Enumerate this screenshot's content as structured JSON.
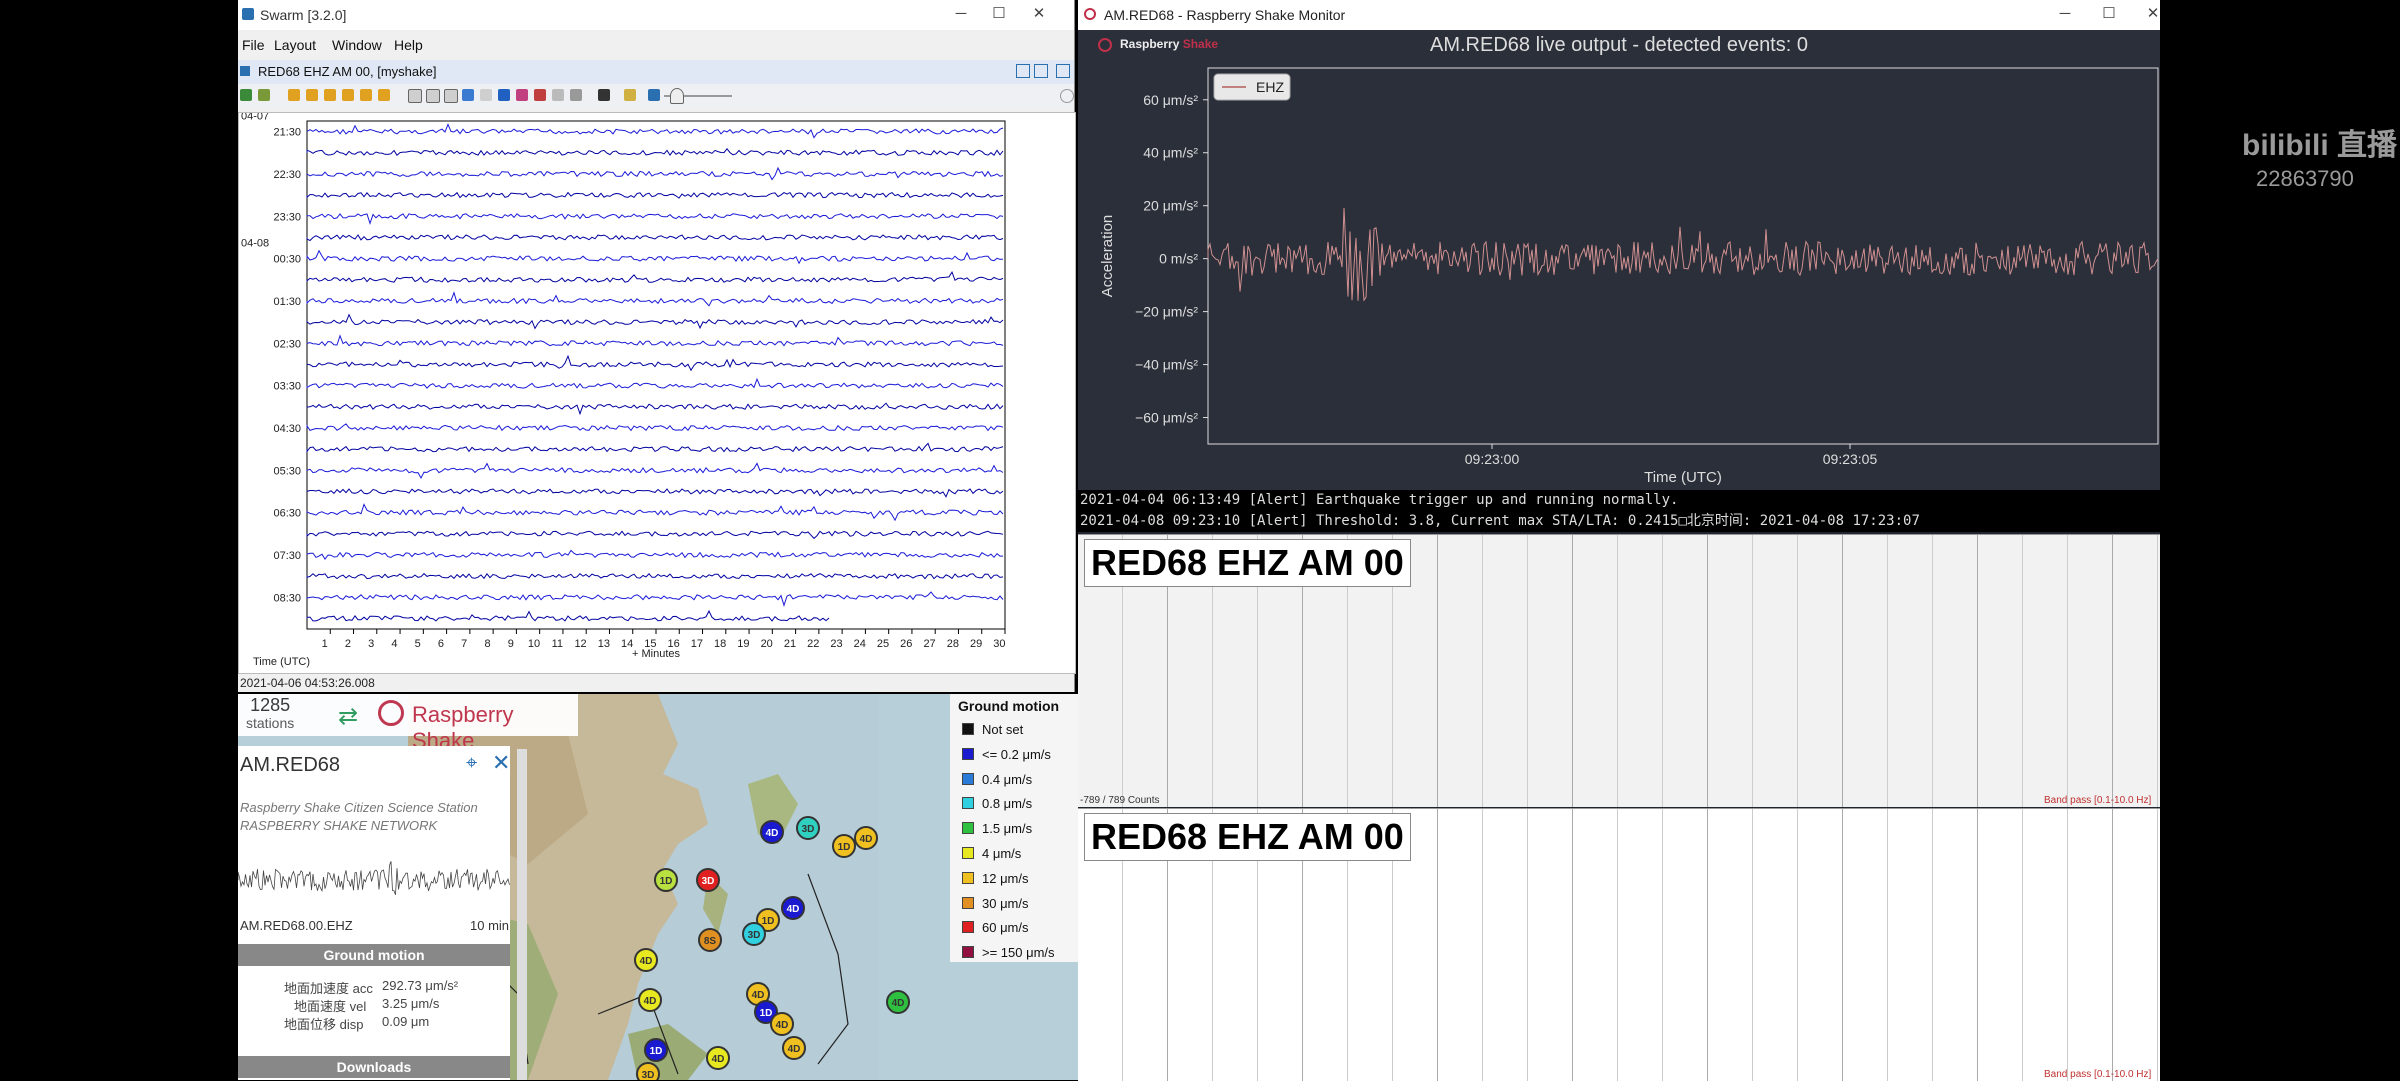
{
  "swarm": {
    "title": "Swarm [3.2.0]",
    "menu": [
      "File",
      "Layout",
      "Window",
      "Help"
    ],
    "subtitle": "RED68 EHZ AM 00, [myshake]",
    "row_labels": [
      {
        "time": "21:30",
        "date": "04-07"
      },
      {
        "time": "22:30",
        "date": ""
      },
      {
        "time": "23:30",
        "date": ""
      },
      {
        "time": "00:30",
        "date": "04-08"
      },
      {
        "time": "01:30",
        "date": ""
      },
      {
        "time": "02:30",
        "date": ""
      },
      {
        "time": "03:30",
        "date": ""
      },
      {
        "time": "04:30",
        "date": ""
      },
      {
        "time": "05:30",
        "date": ""
      },
      {
        "time": "06:30",
        "date": ""
      },
      {
        "time": "07:30",
        "date": ""
      },
      {
        "time": "08:30",
        "date": ""
      }
    ],
    "x_ticks": [
      "1",
      "2",
      "3",
      "4",
      "5",
      "6",
      "7",
      "8",
      "9",
      "10",
      "11",
      "12",
      "13",
      "14",
      "15",
      "16",
      "17",
      "18",
      "19",
      "20",
      "21",
      "22",
      "23",
      "24",
      "25",
      "26",
      "27",
      "28",
      "29",
      "30"
    ],
    "x_label": "+ Minutes",
    "time_label": "Time (UTC)",
    "status": "2021-04-06 04:53:26.008"
  },
  "map": {
    "count": "1285",
    "count_label": "stations",
    "brand": "Raspberry Shake",
    "station": {
      "name": "AM.RED68",
      "desc1": "Raspberry Shake Citizen Science Station",
      "desc2": "RASPBERRY SHAKE NETWORK",
      "trace_label": "AM.RED68.00.EHZ",
      "trace_dur": "10 min",
      "ground_motion_title": "Ground motion",
      "acc_label": "地面加速度 acc",
      "acc_value": "292.73 μm/s²",
      "vel_label": "地面速度 vel",
      "vel_value": "3.25 μm/s",
      "disp_label": "地面位移 disp",
      "disp_value": "0.09 μm",
      "downloads": "Downloads"
    },
    "legend": {
      "title": "Ground motion",
      "items": [
        {
          "label": "Not set",
          "color": "#111111"
        },
        {
          "label": "<= 0.2 μm/s",
          "color": "#1a1ad0"
        },
        {
          "label": "0.4 μm/s",
          "color": "#2a7ad8"
        },
        {
          "label": "0.8 μm/s",
          "color": "#30d0e0"
        },
        {
          "label": "1.5 μm/s",
          "color": "#30c040"
        },
        {
          "label": "4 μm/s",
          "color": "#e8e820"
        },
        {
          "label": "12 μm/s",
          "color": "#f0c020"
        },
        {
          "label": "30 μm/s",
          "color": "#e09020"
        },
        {
          "label": "60 μm/s",
          "color": "#e02020"
        },
        {
          "label": ">= 150 μm/s",
          "color": "#901040"
        }
      ]
    },
    "markers": [
      {
        "label": "1D",
        "color": "#b8e040"
      },
      {
        "label": "3D",
        "color": "#e02020"
      },
      {
        "label": "4D",
        "color": "#1a1ad0"
      },
      {
        "label": "3D",
        "color": "#30d0c0"
      },
      {
        "label": "1D",
        "color": "#f0c020"
      },
      {
        "label": "4D",
        "color": "#f0c020"
      },
      {
        "label": "4D",
        "color": "#1a1ad0"
      },
      {
        "label": "1D",
        "color": "#f0c020"
      },
      {
        "label": "3D",
        "color": "#30d0e0"
      },
      {
        "label": "8S",
        "color": "#e09020"
      },
      {
        "label": "4D",
        "color": "#e8e820"
      },
      {
        "label": "4D",
        "color": "#e8e820"
      },
      {
        "label": "4D",
        "color": "#f0c020"
      },
      {
        "label": "1D",
        "color": "#1a1ad0"
      },
      {
        "label": "4D",
        "color": "#f0c020"
      },
      {
        "label": "4D",
        "color": "#f0c020"
      },
      {
        "label": "4D",
        "color": "#30c040"
      },
      {
        "label": "1D",
        "color": "#1a1ad0"
      },
      {
        "label": "4D",
        "color": "#e8e820"
      },
      {
        "label": "3D",
        "color": "#f0c020"
      }
    ]
  },
  "monitor": {
    "title": "AM.RED68 - Raspberry Shake Monitor",
    "logo": "Raspberry",
    "logo2": "Shake",
    "plot_title": "AM.RED68 live output - detected events: 0",
    "legend": "EHZ",
    "y_label": "Acceleration",
    "y_ticks": [
      "60 μm/s²",
      "40 μm/s²",
      "20 μm/s²",
      "0 m/s²",
      "−20 μm/s²",
      "−40 μm/s²",
      "−60 μm/s²"
    ],
    "x_ticks": [
      "09:23:00",
      "09:23:05"
    ],
    "x_label": "Time (UTC)",
    "log": [
      "2021-04-04 06:13:49 [Alert] Earthquake trigger up and running normally.",
      "2021-04-08 09:23:10 [Alert] Threshold: 3.8, Current max STA/LTA: 0.2415□北京时间: 2021-04-08 17:23:07"
    ],
    "panel1_title": "RED68 EHZ AM 00",
    "panel1_counts": "-789 / 789 Counts",
    "panel1_band": "Band pass [0.1-10.0 Hz]",
    "panel2_title": "RED68 EHZ AM 00",
    "panel2_band": "Band pass [0.1-10.0 Hz]"
  },
  "overlay": {
    "bili": "bilibili 直播",
    "id": "22863790"
  }
}
